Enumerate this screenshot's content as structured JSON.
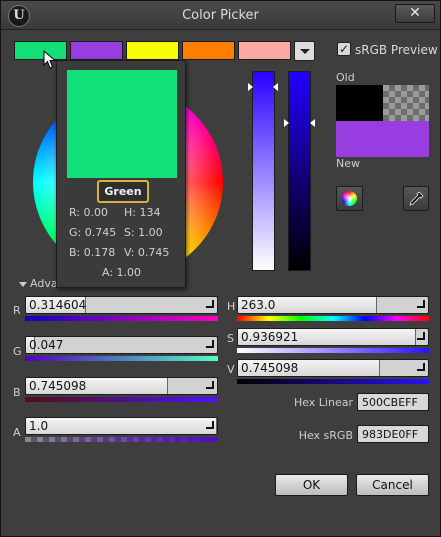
{
  "window": {
    "title": "Color Picker",
    "close_glyph": "✕",
    "logo_text": "U"
  },
  "swatches": [
    "#12df78",
    "#983de0",
    "#f6ff00",
    "#ff7e00",
    "#ffa9a4"
  ],
  "srgb_preview": {
    "label": "sRGB Preview",
    "checked": true
  },
  "old_label": "Old",
  "new_label": "New",
  "old_color": "#000000",
  "new_color": "#983de0",
  "advanced_label": "Adva",
  "channels": {
    "R": {
      "label": "R",
      "value": "0.314604",
      "fill": 0.314604
    },
    "G": {
      "label": "G",
      "value": "0.047",
      "fill": 0.047
    },
    "B": {
      "label": "B",
      "value": "0.745098",
      "fill": 0.745098
    },
    "A": {
      "label": "A",
      "value": "1.0",
      "fill": 1.0
    },
    "H": {
      "label": "H",
      "value": "263.0",
      "fill": 0.73
    },
    "S": {
      "label": "S",
      "value": "0.936921",
      "fill": 0.936921
    },
    "V": {
      "label": "V",
      "value": "0.745098",
      "fill": 0.745098
    }
  },
  "hex_linear": {
    "label": "Hex Linear",
    "value": "500CBEFF"
  },
  "hex_srgb": {
    "label": "Hex sRGB",
    "value": "983DE0FF"
  },
  "buttons": {
    "ok": "OK",
    "cancel": "Cancel"
  },
  "tooltip": {
    "name": "Green",
    "color": "#12df78",
    "r": "R: 0.00",
    "h": "H: 134",
    "g": "G: 0.745",
    "s": "S: 1.00",
    "b": "B: 0.178",
    "v": "V: 0.745",
    "a": "A: 1.00"
  },
  "icons": [
    "unreal-logo-icon",
    "close-icon",
    "chevron-down-icon",
    "checkbox-icon",
    "color-wheel-icon",
    "eyedropper-icon",
    "mouse-cursor-icon"
  ]
}
